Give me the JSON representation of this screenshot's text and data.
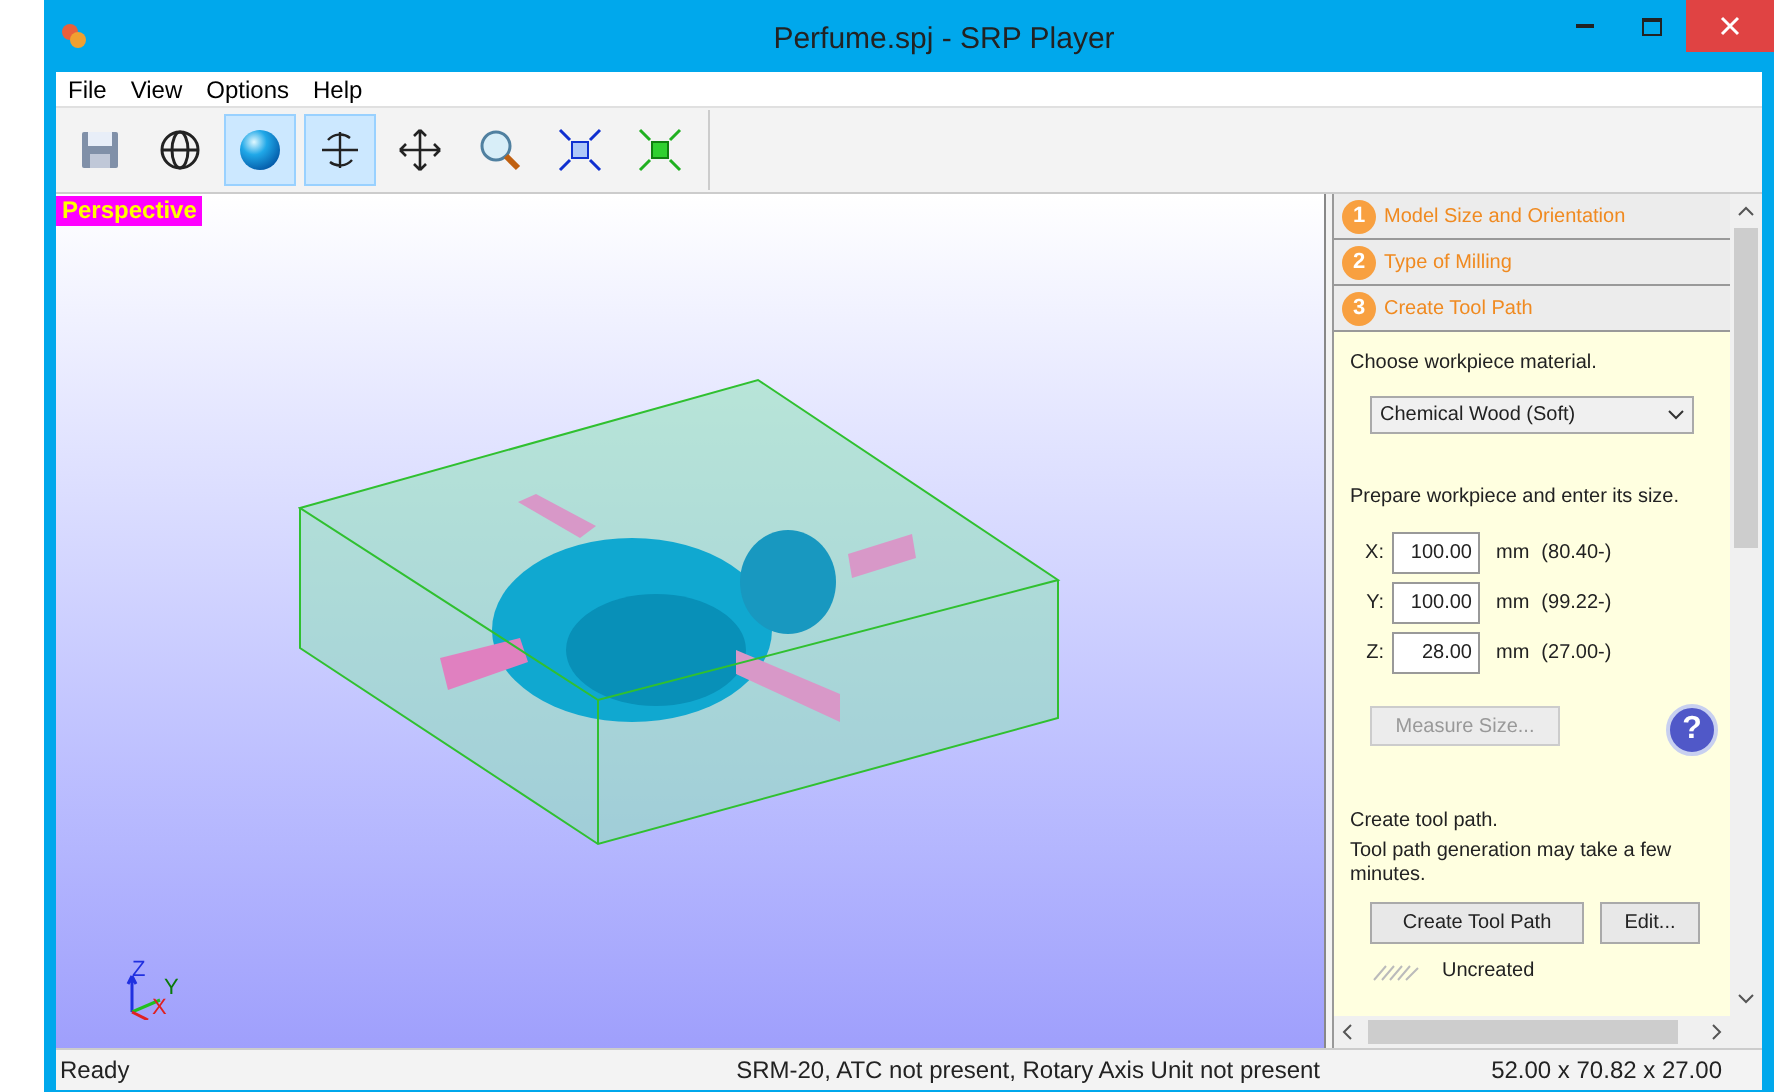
{
  "window": {
    "title": "Perfume.spj - SRP Player"
  },
  "menu": [
    "File",
    "View",
    "Options",
    "Help"
  ],
  "toolbar": [
    {
      "kind": "save",
      "selected": false
    },
    {
      "kind": "wireframe",
      "selected": false
    },
    {
      "kind": "shaded",
      "selected": true
    },
    {
      "kind": "rotate",
      "selected": true
    },
    {
      "kind": "pan",
      "selected": false
    },
    {
      "kind": "zoom",
      "selected": false
    },
    {
      "kind": "fit",
      "selected": false
    },
    {
      "kind": "fit-model",
      "selected": false
    }
  ],
  "viewport": {
    "label": "Perspective",
    "axes": [
      "Z",
      "Y",
      "X"
    ]
  },
  "steps": [
    {
      "number": "1",
      "label": "Model Size and Orientation"
    },
    {
      "number": "2",
      "label": "Type of Milling"
    },
    {
      "number": "3",
      "label": "Create Tool Path"
    }
  ],
  "panel": {
    "material_prompt": "Choose workpiece material.",
    "material": "Chemical Wood (Soft)",
    "size_prompt": "Prepare workpiece and enter its size.",
    "sizes": [
      {
        "axis": "X:",
        "value": "100.00",
        "unit": "mm",
        "min": "(80.40-)"
      },
      {
        "axis": "Y:",
        "value": "100.00",
        "unit": "mm",
        "min": "(99.22-)"
      },
      {
        "axis": "Z:",
        "value": "28.00",
        "unit": "mm",
        "min": "(27.00-)"
      }
    ],
    "help": "?",
    "measure": {
      "label": "Measure Size...",
      "disabled": true
    },
    "path_title": "Create tool path.",
    "path_note": "Tool path generation may take a few minutes.",
    "buttons": [
      "Create Tool Path",
      "Edit..."
    ],
    "status": "Uncreated"
  },
  "status_bar": {
    "left": "Ready",
    "middle": "SRM-20, ATC not present, Rotary Axis Unit not present",
    "right": "52.00 x  70.82 x  27.00"
  }
}
